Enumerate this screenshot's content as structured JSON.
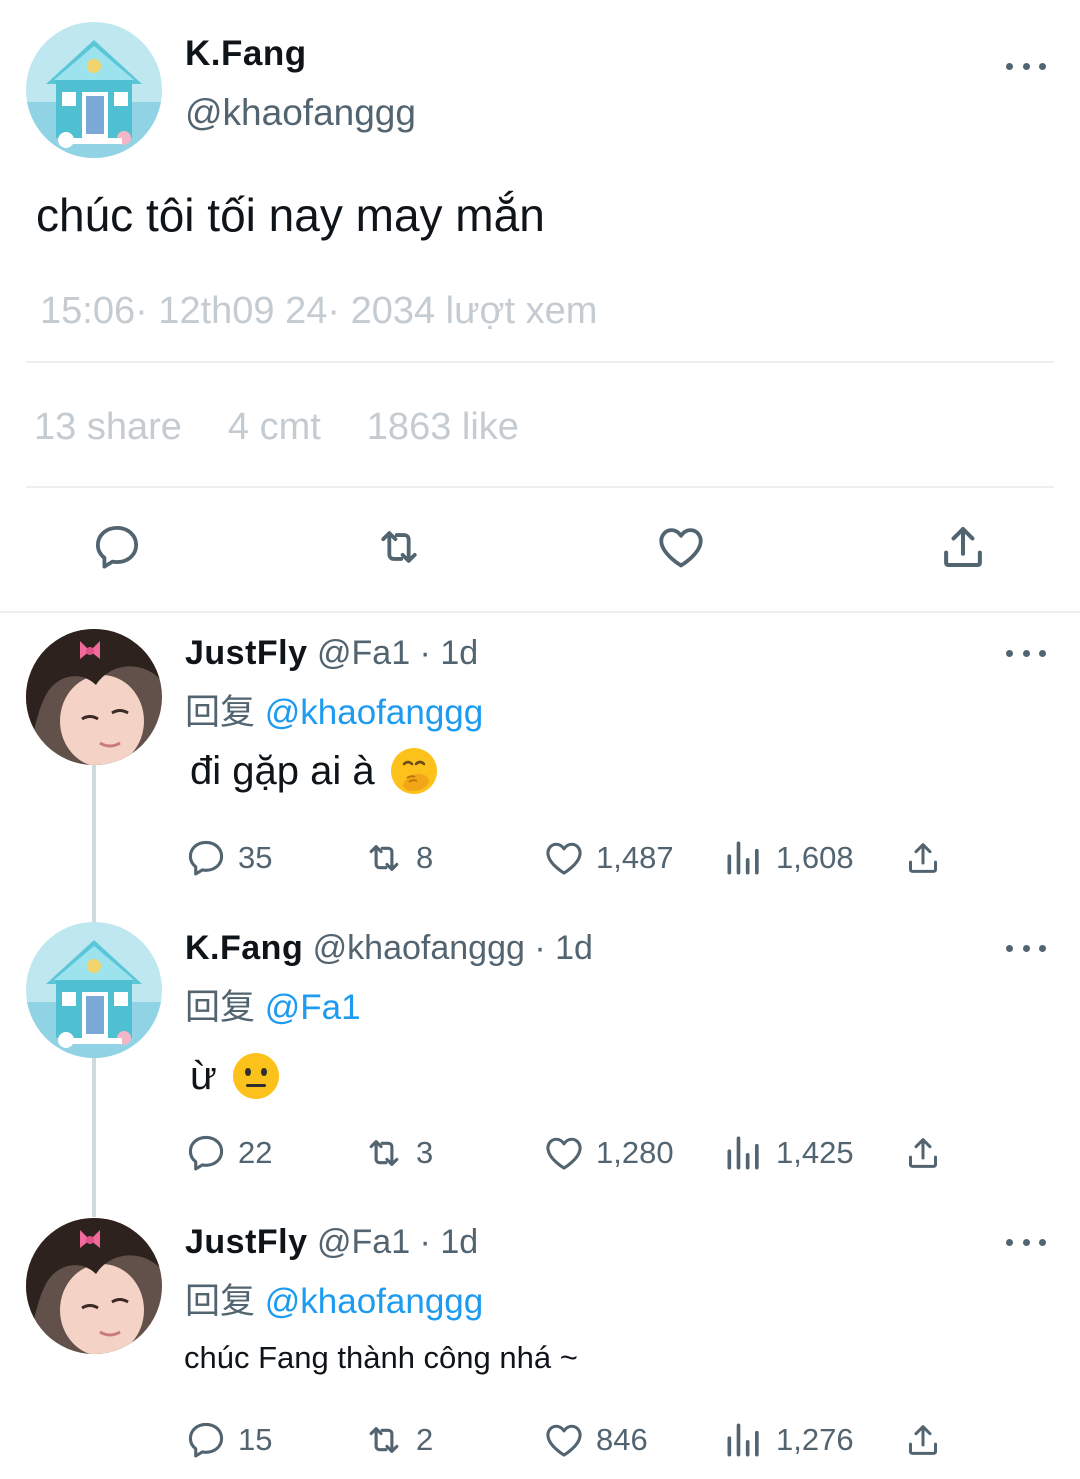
{
  "main_tweet": {
    "name": "K.Fang",
    "handle": "@khaofanggg",
    "text": "chúc tôi tối nay may mắn",
    "meta": "15:06· 12th09 24· 2034 lượt xem",
    "stats": {
      "shares": "13 share",
      "comments": "4 cmt",
      "likes": "1863 like"
    }
  },
  "replies": [
    {
      "name": "JustFly",
      "handle_time": "@Fa1 · 1d",
      "replying_prefix": "回复",
      "replying_to": "@khaofanggg",
      "text": "đi gặp ai à",
      "emoji": "hand-over-mouth-emoji",
      "replies": "35",
      "retweets": "8",
      "likes": "1,487",
      "views": "1,608"
    },
    {
      "name": "K.Fang",
      "handle_time": "@khaofanggg · 1d",
      "replying_prefix": "回复",
      "replying_to": "@Fa1",
      "text": "ừ",
      "emoji": "neutral-face-emoji",
      "replies": "22",
      "retweets": "3",
      "likes": "1,280",
      "views": "1,425"
    },
    {
      "name": "JustFly",
      "handle_time": "@Fa1 · 1d",
      "replying_prefix": "回复",
      "replying_to": "@khaofanggg",
      "text": "chúc Fang thành công nhá ~",
      "replies": "15",
      "retweets": "2",
      "likes": "846",
      "views": "1,276"
    }
  ],
  "colors": {
    "accent": "#1d9bf0",
    "secondary_text": "#536471",
    "faded_text": "#c4cbd1",
    "divider": "#eceff1"
  }
}
